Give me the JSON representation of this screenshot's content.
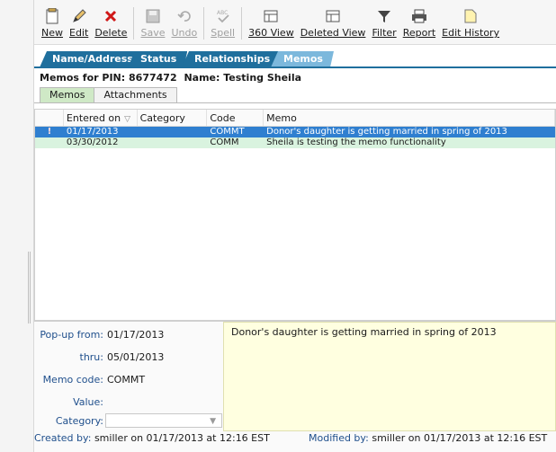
{
  "toolbar": {
    "buttons": [
      {
        "label": "New",
        "icon": "new-record-icon",
        "enabled": true
      },
      {
        "label": "Edit",
        "icon": "pencil-icon",
        "enabled": true
      },
      {
        "label": "Delete",
        "icon": "delete-x-icon",
        "enabled": true
      },
      {
        "label": "Save",
        "icon": "floppy-disk-icon",
        "enabled": false
      },
      {
        "label": "Undo",
        "icon": "undo-arrow-icon",
        "enabled": false
      },
      {
        "label": "Spell",
        "icon": "spell-check-icon",
        "enabled": false
      },
      {
        "label": "360 View",
        "icon": "grid-view-icon",
        "enabled": true
      },
      {
        "label": "Deleted View",
        "icon": "grid-view-icon",
        "enabled": true
      },
      {
        "label": "Filter",
        "icon": "funnel-icon",
        "enabled": true
      },
      {
        "label": "Report",
        "icon": "printer-icon",
        "enabled": true
      },
      {
        "label": "Edit History",
        "icon": "document-icon",
        "enabled": true
      }
    ]
  },
  "module_tabs": [
    "Name/Address",
    "Status",
    "Relationships",
    "Memos"
  ],
  "active_module_tab": "Memos",
  "header": {
    "pin_label": "Memos for PIN:",
    "pin": "8677472",
    "name_label": "Name:",
    "name": "Testing Sheila"
  },
  "sub_tabs": [
    "Memos",
    "Attachments"
  ],
  "grid": {
    "columns": [
      "Entered on",
      "Category",
      "Code",
      "Memo"
    ],
    "rows": [
      {
        "flag": "!",
        "entered_on": "01/17/2013",
        "category": "",
        "code": "COMMT",
        "memo": "Donor's daughter is getting married in spring of 2013",
        "selected": true
      },
      {
        "flag": "",
        "entered_on": "03/30/2012",
        "category": "",
        "code": "COMM",
        "memo": "Sheila is testing the memo functionality",
        "selected": false
      }
    ]
  },
  "details": {
    "popup_from_label": "Pop-up from:",
    "popup_from": "01/17/2013",
    "thru_label": "thru:",
    "thru": "05/01/2013",
    "memo_code_label": "Memo code:",
    "memo_code": "COMMT",
    "value_label": "Value:",
    "value": "",
    "category_label": "Category:",
    "category": "",
    "memo_text": "Donor's daughter is getting married in spring of 2013"
  },
  "footer": {
    "created_label": "Created by:",
    "created_text": "smiller on 01/17/2013 at 12:16 EST",
    "modified_label": "Modified by:",
    "modified_text": "smiller on 01/17/2013 at 12:16 EST"
  },
  "colors": {
    "tab_blue": "#1f6f9d",
    "tab_active": "#7cb8dc",
    "selection": "#2f7fd0",
    "alt_row": "#d9f3df",
    "memo_bg": "#ffffe0"
  }
}
